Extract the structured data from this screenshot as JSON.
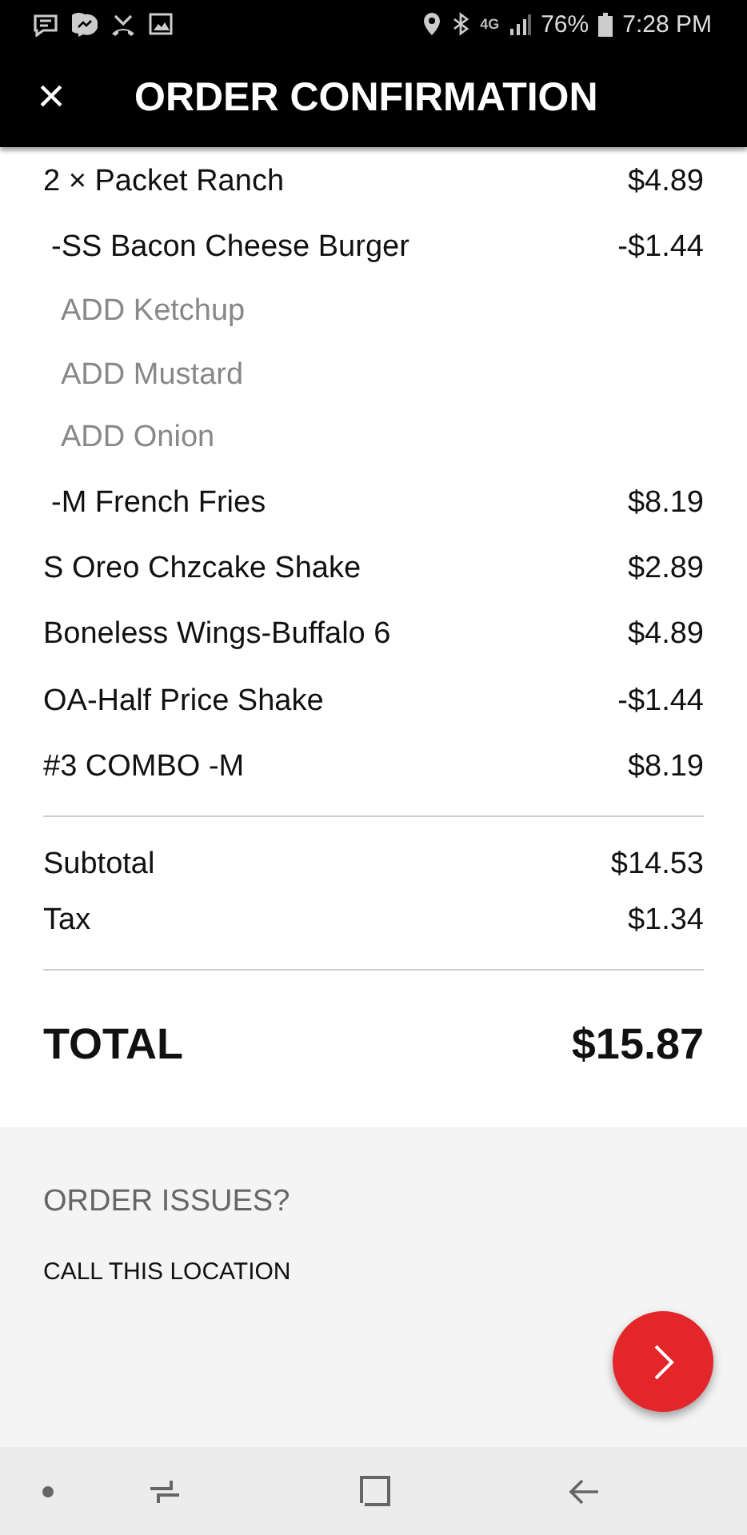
{
  "status_bar": {
    "network": "4G",
    "battery": "76%",
    "time": "7:28 PM"
  },
  "header": {
    "close": "×",
    "title": "ORDER CONFIRMATION"
  },
  "items": [
    {
      "kind": "item",
      "name": "2 × Packet Ranch",
      "price": "$4.89"
    },
    {
      "kind": "sub",
      "name": "-SS Bacon Cheese Burger",
      "price": "-$1.44"
    },
    {
      "kind": "modifier",
      "name": "ADD Ketchup"
    },
    {
      "kind": "modifier",
      "name": "ADD Mustard"
    },
    {
      "kind": "modifier",
      "name": "ADD Onion"
    },
    {
      "kind": "sub",
      "name": "-M French Fries",
      "price": "$8.19"
    },
    {
      "kind": "item",
      "name": "S Oreo Chzcake Shake",
      "price": "$2.89"
    },
    {
      "kind": "item",
      "name": "Boneless Wings-Buffalo 6",
      "price": "$4.89"
    },
    {
      "kind": "item",
      "name": "OA-Half Price Shake",
      "price": "-$1.44"
    },
    {
      "kind": "item",
      "name": "#3 COMBO -M",
      "price": "$8.19"
    }
  ],
  "subtotals": [
    {
      "label": "Subtotal",
      "value": "$14.53"
    },
    {
      "label": "Tax",
      "value": "$1.34"
    }
  ],
  "total": {
    "label": "TOTAL",
    "value": "$15.87"
  },
  "issues": {
    "heading": "ORDER ISSUES?",
    "link": "CALL THIS LOCATION"
  }
}
